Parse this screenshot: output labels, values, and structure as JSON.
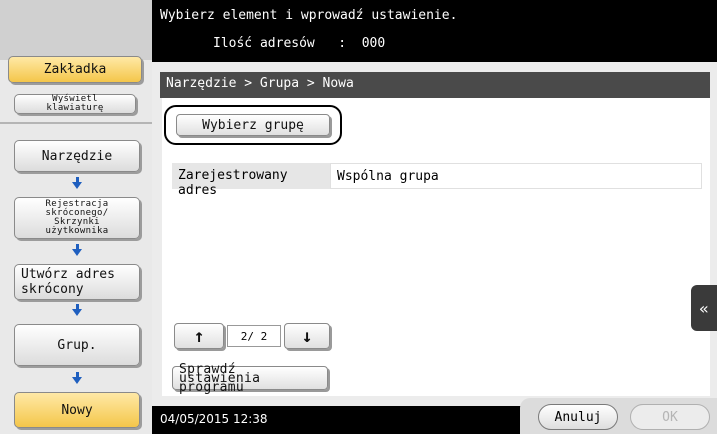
{
  "header": {
    "instruction": "Wybierz element i wprowadź ustawienie.",
    "address_count": "Ilość adresów   :  000"
  },
  "sidebar": {
    "bookmark": "Zakładka",
    "show_keyboard": "Wyświetl klawiaturę",
    "steps": [
      {
        "label": "Narzędzie"
      },
      {
        "label": "Rejestracja skróconego/ Skrzynki użytkownika"
      },
      {
        "label": "Utwórz adres skrócony"
      },
      {
        "label": "Grup."
      },
      {
        "label": "Nowy"
      }
    ]
  },
  "main": {
    "breadcrumb": "Narzędzie > Grupa > Nowa",
    "select_group_button": "Wybierz grupę",
    "registered_address_label": "Zarejestrowany adres",
    "registered_address_value": "Wspólna grupa",
    "page_indicator": "2/ 2",
    "check_settings_button": "Sprawdź ustawienia programu"
  },
  "footer": {
    "datetime": "04/05/2015  12:38",
    "cancel": "Anuluj",
    "ok": "OK"
  },
  "icons": {
    "step_arrow": "arrow-down-icon",
    "page_up": "arrow-up-icon",
    "page_down": "arrow-down-icon",
    "side_panel": "double-chevron-left-icon"
  },
  "colors": {
    "selected_bg": "#f4c64a",
    "arrow": "#1f5fbf",
    "header_bg": "#000000"
  }
}
